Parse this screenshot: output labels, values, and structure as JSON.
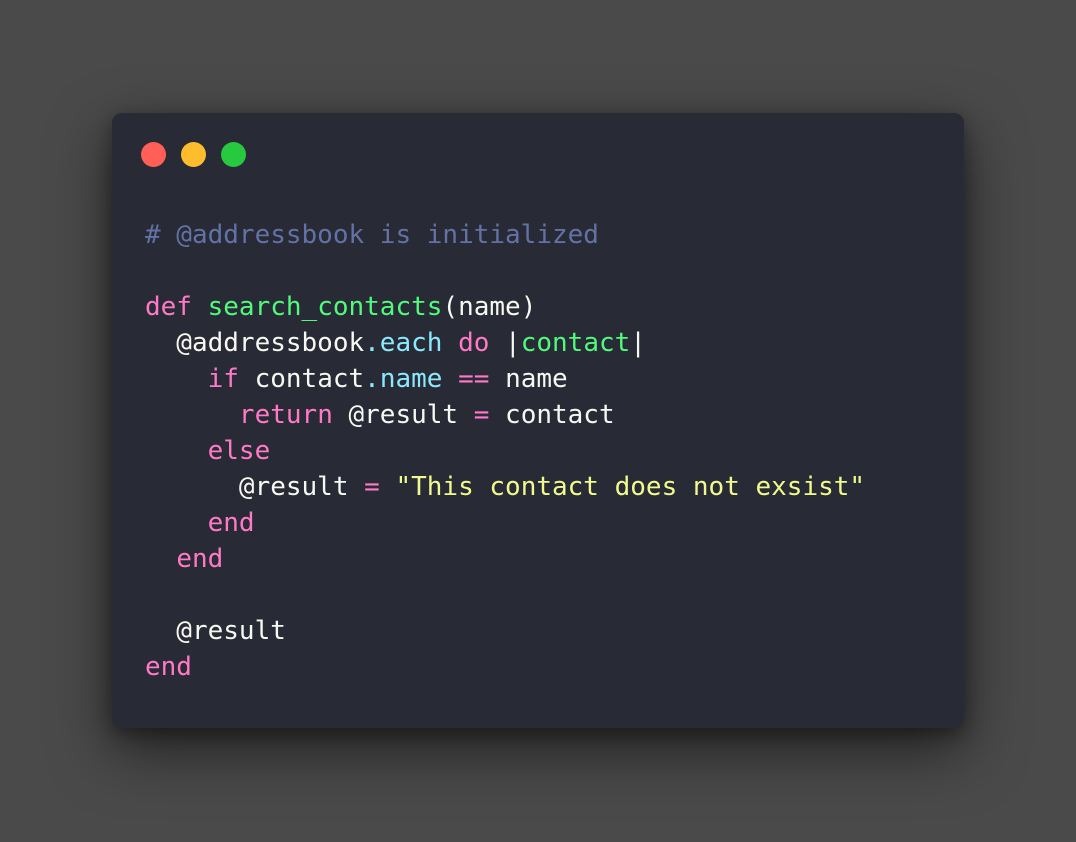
{
  "window": {
    "controls": {
      "close_color": "#ff5f56",
      "minimize_color": "#ffbd2e",
      "maximize_color": "#27c93f"
    }
  },
  "theme": {
    "background": "#4a4a4a",
    "editor_background": "#282a36",
    "comment": "#6272a4",
    "keyword": "#ff79c6",
    "function": "#50fa7b",
    "method": "#8be9fd",
    "string": "#f1fa8c",
    "text": "#f8f8f2"
  },
  "code": {
    "lines": [
      [
        {
          "t": "# @addressbook is initialized",
          "k": "comment"
        }
      ],
      [],
      [
        {
          "t": "def",
          "k": "kw"
        },
        {
          "t": " ",
          "k": "plain"
        },
        {
          "t": "search_contacts",
          "k": "fn"
        },
        {
          "t": "(name)",
          "k": "plain"
        }
      ],
      [
        {
          "t": "  @addressbook",
          "k": "plain"
        },
        {
          "t": ".each",
          "k": "method"
        },
        {
          "t": " ",
          "k": "plain"
        },
        {
          "t": "do",
          "k": "kw"
        },
        {
          "t": " |",
          "k": "plain"
        },
        {
          "t": "contact",
          "k": "fn"
        },
        {
          "t": "|",
          "k": "plain"
        }
      ],
      [
        {
          "t": "    ",
          "k": "plain"
        },
        {
          "t": "if",
          "k": "kw"
        },
        {
          "t": " contact",
          "k": "plain"
        },
        {
          "t": ".name",
          "k": "method"
        },
        {
          "t": " ",
          "k": "plain"
        },
        {
          "t": "==",
          "k": "kw"
        },
        {
          "t": " name",
          "k": "plain"
        }
      ],
      [
        {
          "t": "      ",
          "k": "plain"
        },
        {
          "t": "return",
          "k": "kw"
        },
        {
          "t": " @result ",
          "k": "plain"
        },
        {
          "t": "=",
          "k": "kw"
        },
        {
          "t": " contact",
          "k": "plain"
        }
      ],
      [
        {
          "t": "    ",
          "k": "plain"
        },
        {
          "t": "else",
          "k": "kw"
        }
      ],
      [
        {
          "t": "      @result ",
          "k": "plain"
        },
        {
          "t": "=",
          "k": "kw"
        },
        {
          "t": " ",
          "k": "plain"
        },
        {
          "t": "\"This contact does not exsist\"",
          "k": "str"
        }
      ],
      [
        {
          "t": "    ",
          "k": "plain"
        },
        {
          "t": "end",
          "k": "kw"
        }
      ],
      [
        {
          "t": "  ",
          "k": "plain"
        },
        {
          "t": "end",
          "k": "kw"
        }
      ],
      [],
      [
        {
          "t": "  @result",
          "k": "plain"
        }
      ],
      [
        {
          "t": "end",
          "k": "kw"
        }
      ]
    ]
  }
}
